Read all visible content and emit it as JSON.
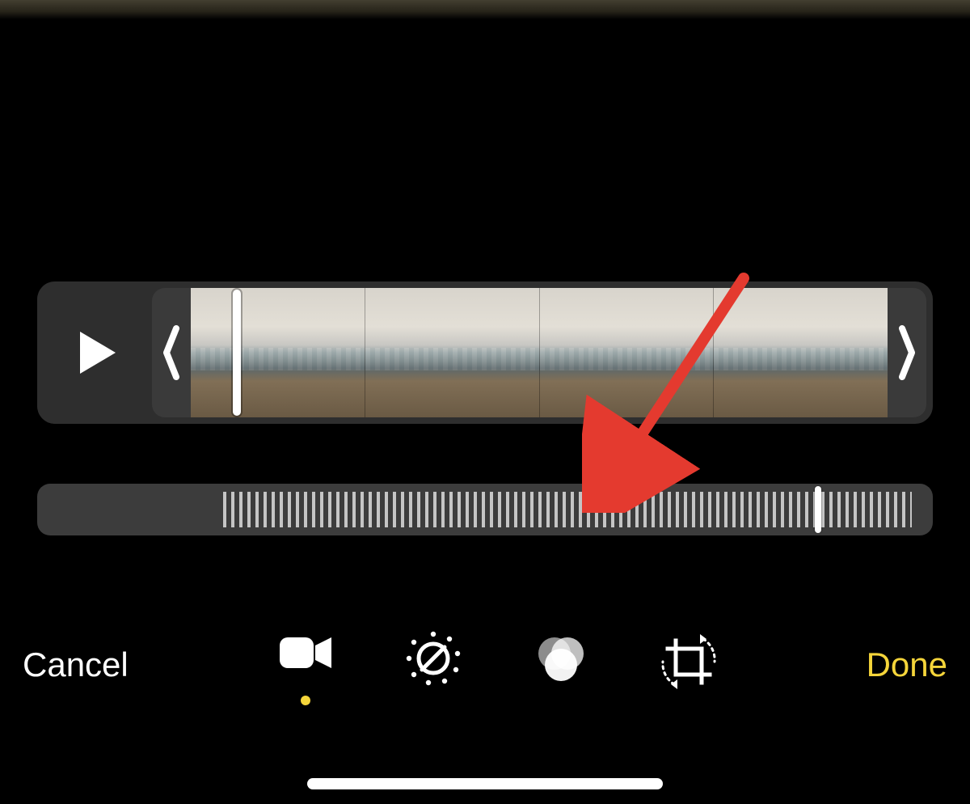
{
  "top_strip": {},
  "timeline": {
    "play_icon": "play-icon",
    "frames_count": 4,
    "trim_left_icon": "chevron-left-icon",
    "trim_right_icon": "chevron-right-icon"
  },
  "speed_slider": {
    "marker_position_percent": 87
  },
  "annotation": {
    "color": "#e43a2f"
  },
  "toolbar": {
    "cancel_label": "Cancel",
    "done_label": "Done",
    "done_color": "#f5d53a",
    "tools": [
      {
        "name": "video-tool",
        "icon": "video-camera-icon",
        "selected": true
      },
      {
        "name": "adjust-tool",
        "icon": "adjust-dial-icon",
        "selected": false
      },
      {
        "name": "filters-tool",
        "icon": "filters-circles-icon",
        "selected": false
      },
      {
        "name": "crop-tool",
        "icon": "crop-rotate-icon",
        "selected": false
      }
    ]
  }
}
